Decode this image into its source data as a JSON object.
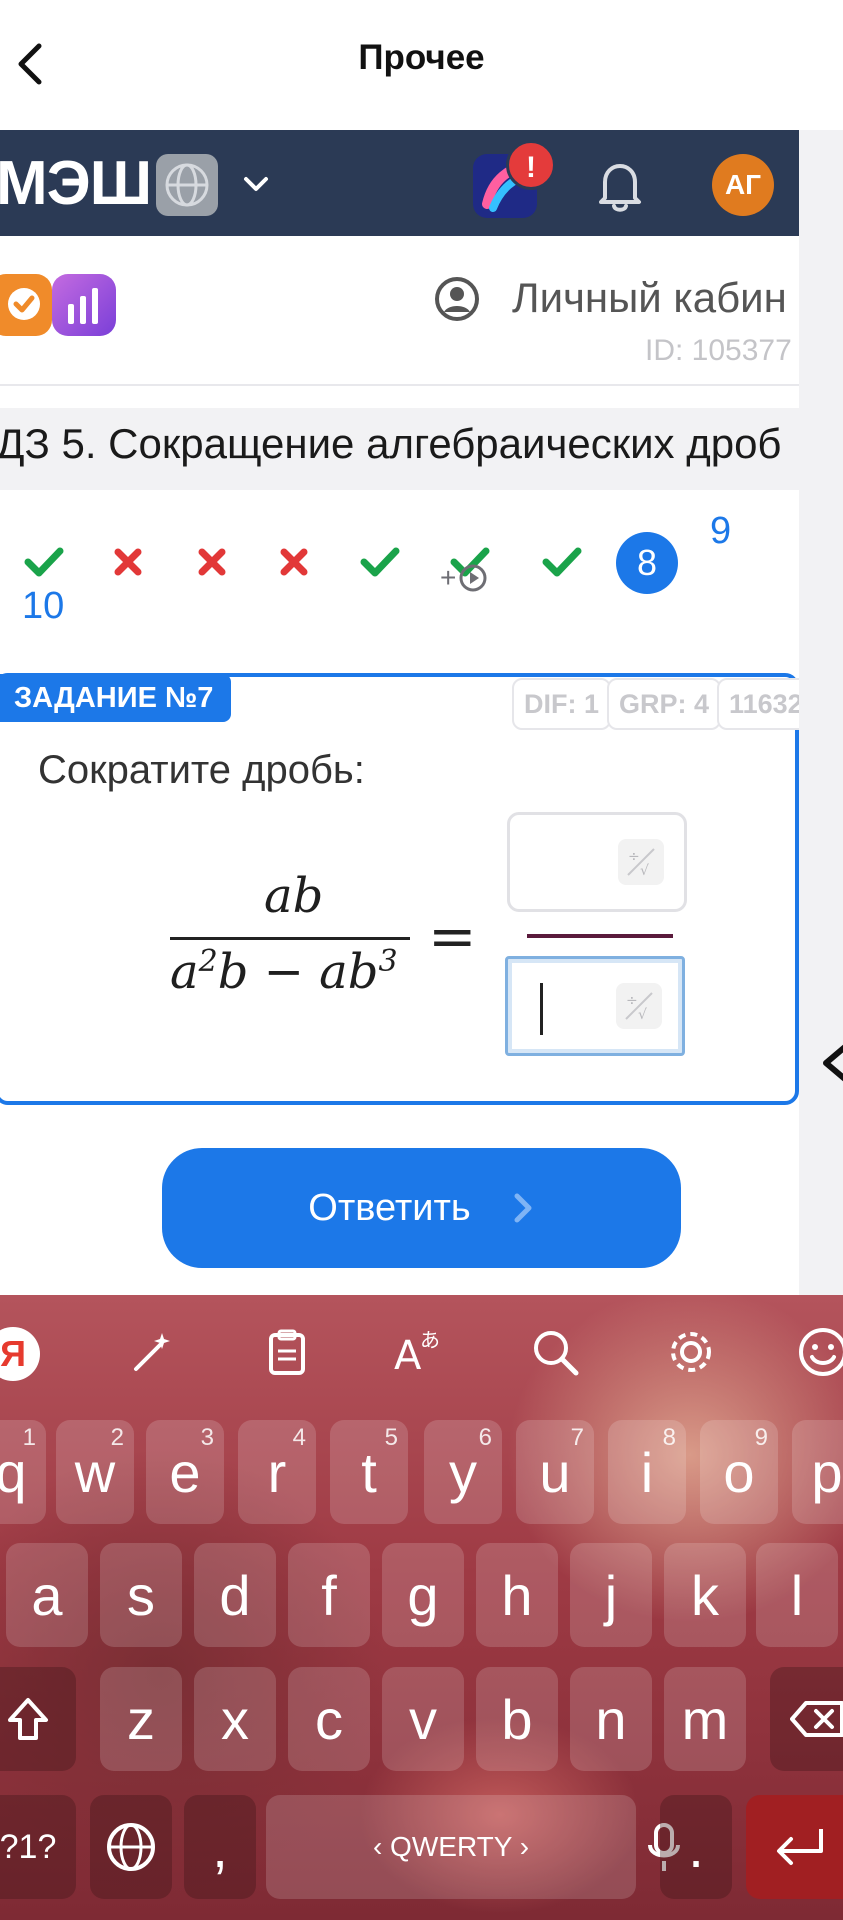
{
  "nav": {
    "title": "Прочее"
  },
  "header": {
    "logo": "МЭШ",
    "alert_count": "!",
    "avatar_initials": "АГ"
  },
  "subheader": {
    "cabinet_label": "Личный кабин",
    "user_id": "ID: 105377"
  },
  "lesson": {
    "title": "ДЗ 5. Сокращение алгебраических дроб"
  },
  "progress": {
    "marks": [
      "correct",
      "wrong",
      "wrong",
      "wrong",
      "correct",
      "correct",
      "correct"
    ],
    "current": "8",
    "next": [
      "9",
      "10"
    ],
    "video_bonus": "+"
  },
  "task": {
    "badge": "ЗАДАНИЕ №7",
    "meta": [
      "DIF: 1",
      "GRP: 4",
      "11632"
    ],
    "prompt": "Сократите дробь:",
    "numerator": "ab",
    "denominator_parts": [
      "a",
      "2",
      "b − ab",
      "3"
    ],
    "equals": "="
  },
  "answer_button": {
    "label": "Ответить"
  },
  "keyboard": {
    "ya_label": "Я",
    "row1": [
      {
        "k": "q",
        "h": "1"
      },
      {
        "k": "w",
        "h": "2"
      },
      {
        "k": "e",
        "h": "3"
      },
      {
        "k": "r",
        "h": "4"
      },
      {
        "k": "t",
        "h": "5"
      },
      {
        "k": "y",
        "h": "6"
      },
      {
        "k": "u",
        "h": "7"
      },
      {
        "k": "i",
        "h": "8"
      },
      {
        "k": "o",
        "h": "9"
      },
      {
        "k": "p",
        "h": ""
      }
    ],
    "row2": [
      "a",
      "s",
      "d",
      "f",
      "g",
      "h",
      "j",
      "k",
      "l"
    ],
    "row3": [
      "z",
      "x",
      "c",
      "v",
      "b",
      "n",
      "m"
    ],
    "symbols_label": "?1?",
    "comma": ",",
    "space_label": "‹ QWERTY ›",
    "period": "."
  },
  "colors": {
    "accent": "#1c78e8",
    "header": "#2b3a55",
    "correct": "#1aa34a",
    "wrong": "#e23838"
  }
}
